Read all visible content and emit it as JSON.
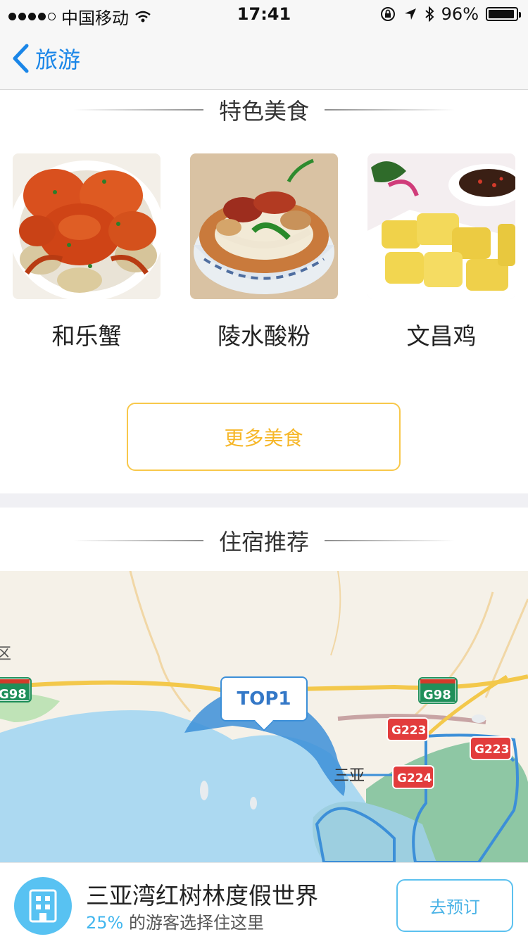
{
  "status_bar": {
    "carrier": "中国移动",
    "time": "17:41",
    "battery_text": "96%",
    "battery_level": 0.96,
    "signal_bars_filled": 4
  },
  "nav": {
    "back_label": "旅游"
  },
  "food_section": {
    "title": "特色美食",
    "items": [
      {
        "name": "和乐蟹"
      },
      {
        "name": "陵水酸粉"
      },
      {
        "name": "文昌鸡"
      }
    ],
    "more_button": "更多美食"
  },
  "lodging_section": {
    "title": "住宿推荐",
    "map": {
      "marker_label": "TOP1",
      "labels": {
        "district_partial": "区",
        "city": "三亚",
        "highway_g98_left": "G98",
        "highway_g98_right": "G98",
        "highway_g223_a": "G223",
        "highway_g223_b": "G223",
        "highway_g224": "G224"
      }
    }
  },
  "hotel_bar": {
    "name": "三亚湾红树林度假世界",
    "percent": "25%",
    "sub_text": " 的游客选择住这里",
    "book_button": "去预订"
  },
  "colors": {
    "accent_blue": "#1a86e8",
    "more_button_yellow": "#f6b729",
    "hotel_blue": "#41b6ee"
  }
}
